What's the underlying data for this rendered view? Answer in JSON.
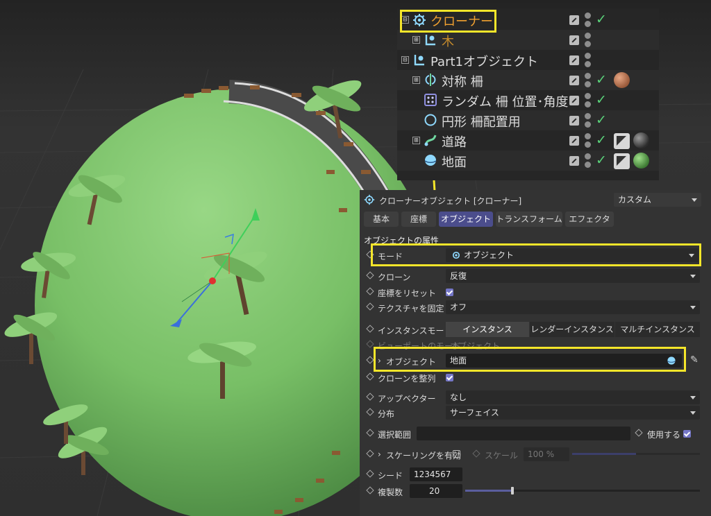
{
  "object_manager": {
    "rows": [
      {
        "name": "クローナー",
        "expand": "⊟"
      },
      {
        "name": "木",
        "expand": "⊞"
      },
      {
        "name": "Part1オブジェクト",
        "expand": "⊟"
      },
      {
        "name": "対称 柵",
        "expand": "⊞"
      },
      {
        "name": "ランダム 柵 位置･角度",
        "expand": ""
      },
      {
        "name": "円形 柵配置用",
        "expand": ""
      },
      {
        "name": "道路",
        "expand": "⊞"
      },
      {
        "name": "地面",
        "expand": ""
      }
    ]
  },
  "attributes": {
    "title": "クローナーオブジェクト [クローナー]",
    "preset": "カスタム",
    "tabs": [
      "基本",
      "座標",
      "オブジェクト",
      "トランスフォーム",
      "エフェクタ"
    ],
    "active_tab": "オブジェクト",
    "section_title": "オブジェクトの属性",
    "mode_label": "モード",
    "mode_value": "オブジェクト",
    "clone_label": "クローン",
    "clone_value": "反復",
    "reset_coords_label": "座標をリセット",
    "reset_coords_checked": true,
    "fix_texture_label": "テクスチャを固定",
    "fix_texture_value": "オフ",
    "instance_mode_label": "インスタンスモード",
    "instance_modes": [
      "インスタンス",
      "レンダーインスタンス",
      "マルチインスタンス"
    ],
    "viewport_mode_label": "ビューポートのモード",
    "viewport_mode_value": "オブジェクト",
    "object_label": "オブジェクト",
    "object_value": "地面",
    "align_clones_label": "クローンを整列",
    "align_clones_checked": true,
    "up_vector_label": "アップベクター",
    "up_vector_value": "なし",
    "distribution_label": "分布",
    "distribution_value": "サーフェイス",
    "selection_label": "選択範囲",
    "selection_value": "",
    "use_label": "使用する",
    "use_checked": true,
    "scaling_label": "スケーリングを有効",
    "scaling_checked": false,
    "scale_label": "スケール",
    "scale_value": "100 %",
    "seed_label": "シード",
    "seed_value": "1234567",
    "count_label": "複製数",
    "count_value": "20",
    "count_slider_fraction": 0.2
  },
  "colors": {
    "highlight": "#f5e62a",
    "accent": "#4b4d8c",
    "ground_green": "#7cc46a",
    "check_green": "#5ad37a"
  },
  "icons": [
    "cloner-icon",
    "null-icon",
    "symmetry-icon",
    "random-icon",
    "circle-icon",
    "spline-icon",
    "sphere-icon",
    "edit-icon",
    "visibility-dots-icon",
    "check-icon",
    "material-tag-icon",
    "pick-icon",
    "expand-icon"
  ]
}
